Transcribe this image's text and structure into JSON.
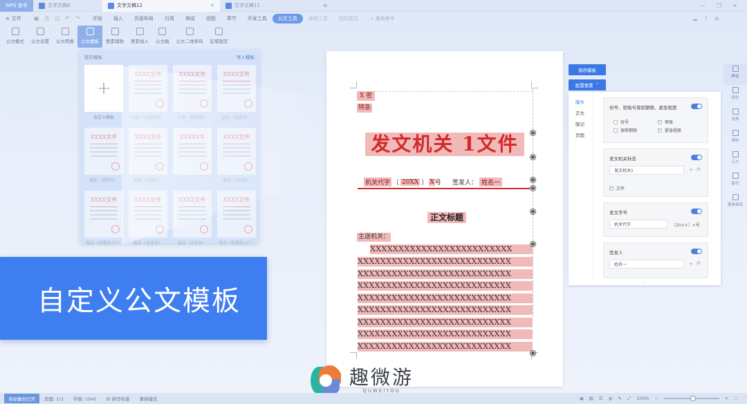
{
  "titlebar": {
    "home_tab": "WPS 金号",
    "tabs": [
      {
        "label": "文字文稿8"
      },
      {
        "label": "文字文稿12"
      },
      {
        "label": "文字文稿11"
      }
    ],
    "add_tab": "+"
  },
  "menubar": {
    "file": "文件",
    "items": [
      "开始",
      "插入",
      "页面布局",
      "引用",
      "审阅",
      "视图",
      "章节",
      "开发工具"
    ],
    "active_tab": "公文工具",
    "faded_items": [
      "表格工具",
      "图纸模式"
    ],
    "search": "查找命令"
  },
  "toolbar": {
    "buttons": [
      "公文模式",
      "公文设置",
      "公文转换",
      "公文模板",
      "要素辅助",
      "要素插入",
      "公文稿",
      "公文二维条码",
      "区域锁定"
    ],
    "active": "公文模板"
  },
  "template_panel": {
    "title": "我的模板",
    "link": "导入模板",
    "items": [
      {
        "caption": "自定义模板",
        "thumb": "",
        "new": true
      },
      {
        "caption": "公告（以机关名）",
        "thumb": "XXXX文件"
      },
      {
        "caption": "公告（带成绩）",
        "thumb": "XXXX文件"
      },
      {
        "caption": "函告（无签名）",
        "thumb": "XXXX文件"
      },
      {
        "caption": "通知（带附件）",
        "thumb": "XXXX文件"
      },
      {
        "caption": "要报（签署名）",
        "thumb": "XXXX文件"
      },
      {
        "caption": "",
        "thumb": "XXXXX令"
      },
      {
        "caption": "请示（1位签）",
        "thumb": "XXXX文件"
      },
      {
        "caption": "报告（签署名2个）",
        "thumb": "XXXX文件"
      },
      {
        "caption": "报告（含签名）",
        "thumb": "XXXX文件"
      },
      {
        "caption": "报告（含签名）",
        "thumb": "XXXX文件"
      },
      {
        "caption": "请示（签署名3个）",
        "thumb": "XXXX文件"
      }
    ]
  },
  "document": {
    "marker": "X 密",
    "urgency": "特急",
    "agency_title": "发文机关 1文件",
    "doc_number": {
      "code": "机关代字",
      "year": "20XX",
      "suffix": "号"
    },
    "signer_label": "签发人：",
    "signer": "姓名一",
    "title": "正文标题",
    "recipient": "主送机关：",
    "body_first": "XXXXXXXXXXXXXXXXXXXXXXXXX",
    "body_lines": [
      "XXXXXXXXXXXXXXXXXXXXXXXXXXX",
      "XXXXXXXXXXXXXXXXXXXXXXXXXXX",
      "XXXXXXXXXXXXXXXXXXXXXXXXXXX",
      "XXXXXXXXXXXXXXXXXXXXXXXXXXX",
      "XXXXXXXXXXXXXXXXXXXXXXXXXXX",
      "XXXXXXXXXXXXXXXXXXXXXXXXXXX",
      "XXXXXXXXXXXXXXXXXXXXXXXXXXX",
      "XXXXXXXXXXXXXXXXXXXXXXXXXXX"
    ]
  },
  "config": {
    "save_button": "保存模板",
    "config_button": "配置要素",
    "nav": [
      "版头",
      "正文",
      "版记",
      "页面"
    ],
    "cards": {
      "secret": {
        "title": "份号、密级与保密期限、紧急程度",
        "options": [
          {
            "label": "份号",
            "checked": false
          },
          {
            "label": "密级",
            "checked": true
          },
          {
            "label": "保密期限",
            "checked": false
          },
          {
            "label": "紧急程度",
            "checked": true
          }
        ]
      },
      "agency": {
        "title": "发文机关标志",
        "value": "发文机关1",
        "check_label": "文件"
      },
      "docnum": {
        "title": "发文字号",
        "value": "机关代字",
        "suffix": "〔20××〕×号"
      },
      "signer": {
        "title": "签发人",
        "value": "姓名一"
      }
    }
  },
  "side_rail": [
    "样式",
    "报告",
    "选择",
    "限制",
    "元与",
    "备份",
    "要素编辑"
  ],
  "banner": "自定义公文模板",
  "watermark": {
    "cn": "趣微游",
    "en": "QUWEIYOU"
  },
  "status": {
    "pill": "自动备份已开",
    "page": "页面: 1/3",
    "words": "字数: 1045",
    "spell": "拼写检查",
    "mode": "兼容模式",
    "zoom": "100%"
  },
  "colors": {
    "accent": "#3b78e6",
    "field": "#f2b9b9",
    "agency_red": "#d32a2a"
  }
}
